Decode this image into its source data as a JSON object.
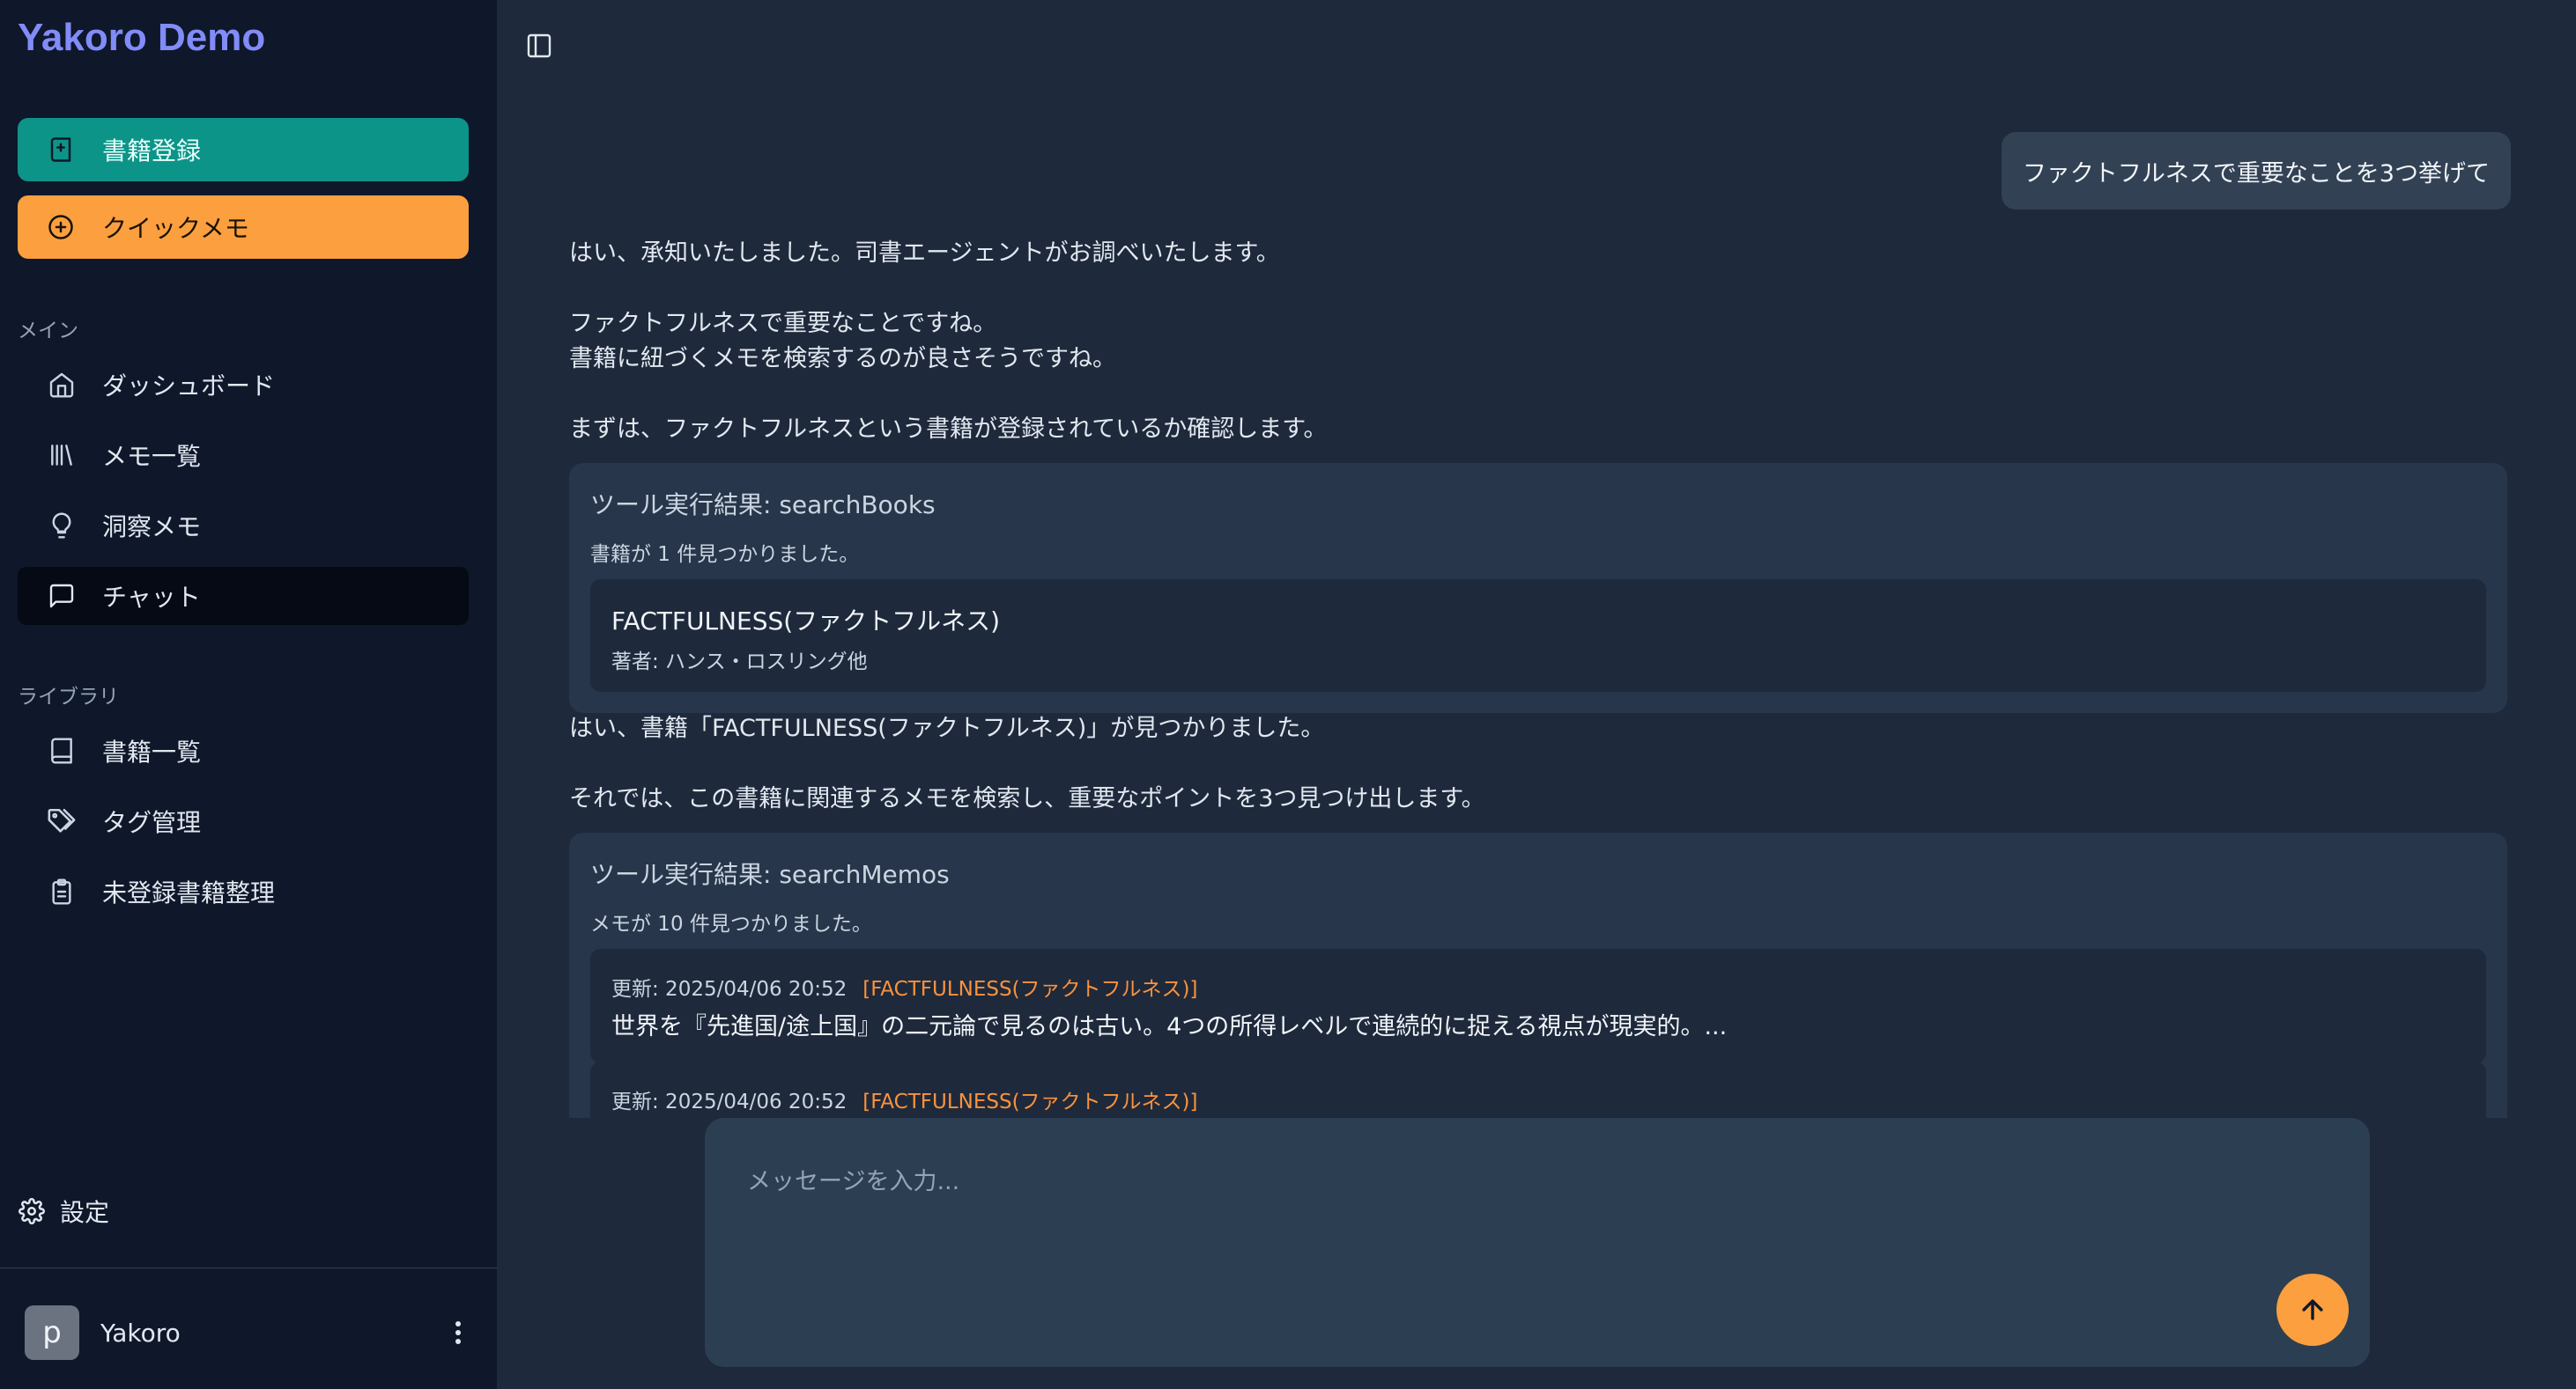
{
  "app": {
    "title": "Yakoro Demo"
  },
  "sidebar": {
    "actions": [
      {
        "label": "書籍登録",
        "icon": "book-plus-icon"
      },
      {
        "label": "クイックメモ",
        "icon": "plus-circle-icon"
      }
    ],
    "sections": [
      {
        "label": "メイン",
        "items": [
          {
            "label": "ダッシュボード",
            "icon": "home-icon"
          },
          {
            "label": "メモ一覧",
            "icon": "library-icon"
          },
          {
            "label": "洞察メモ",
            "icon": "lightbulb-icon"
          },
          {
            "label": "チャット",
            "icon": "message-square-icon",
            "active": true
          }
        ]
      },
      {
        "label": "ライブラリ",
        "items": [
          {
            "label": "書籍一覧",
            "icon": "book-icon"
          },
          {
            "label": "タグ管理",
            "icon": "tags-icon"
          },
          {
            "label": "未登録書籍整理",
            "icon": "clipboard-icon"
          }
        ]
      }
    ],
    "settings_label": "設定",
    "user": {
      "initial": "p",
      "name": "Yakoro"
    }
  },
  "chat": {
    "user_message": "ファクトフルネスで重要なことを3つ挙げて",
    "assistant_paragraphs": [
      "はい、承知いたしました。司書エージェントがお調べいたします。",
      "ファクトフルネスで重要なことですね。",
      "書籍に紐づくメモを検索するのが良さそうですね。",
      "まずは、ファクトフルネスという書籍が登録されているか確認します。",
      "はい、書籍「FACTFULNESS(ファクトフルネス)」が見つかりました。",
      "それでは、この書籍に関連するメモを検索し、重要なポイントを3つ見つけ出します。"
    ],
    "tool_results": [
      {
        "title": "ツール実行結果: searchBooks",
        "count_text": "書籍が 1 件見つかりました。",
        "book": {
          "title": "FACTFULNESS(ファクトフルネス)",
          "author": "著者: ハンス・ロスリング他"
        }
      },
      {
        "title": "ツール実行結果: searchMemos",
        "count_text": "メモが 10 件見つかりました。",
        "memos": [
          {
            "updated": "更新: 2025/04/06 20:52",
            "tag": "[FACTFULNESS(ファクトフルネス)]",
            "text": "世界を『先進国/途上国』の二元論で見るのは古い。4つの所得レベルで連続的に捉える視点が現実的。..."
          },
          {
            "updated": "更新: 2025/04/06 20:52",
            "tag": "[FACTFULNESS(ファクトフルネス)]",
            "text": ""
          }
        ]
      }
    ]
  },
  "composer": {
    "placeholder": "メッセージを入力..."
  },
  "colors": {
    "accent_orange": "#fb9f3f",
    "accent_teal": "#0d9488",
    "brand": "#818cf8",
    "sidebar_bg": "#0f172a",
    "main_bg": "#1e293b"
  }
}
